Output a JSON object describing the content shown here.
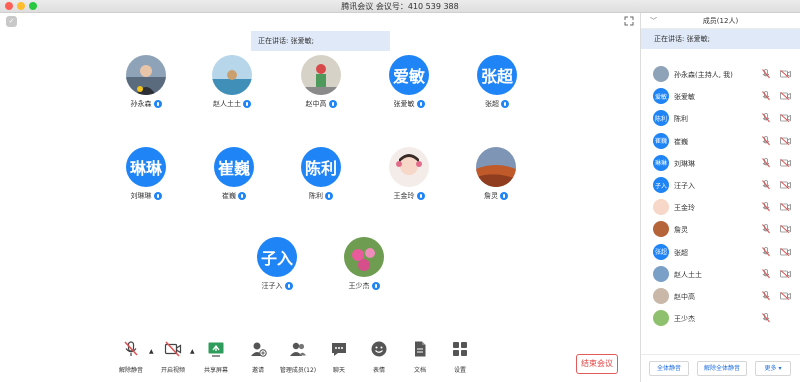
{
  "window": {
    "title": "腾讯会议 会议号：410 539 388"
  },
  "main": {
    "speaking": "正在讲话: 张爱敏;",
    "participants": [
      {
        "name": "孙永森",
        "avatar_type": "photo",
        "avatar_text": ""
      },
      {
        "name": "赵人土土",
        "avatar_type": "photo",
        "avatar_text": ""
      },
      {
        "name": "赵中高",
        "avatar_type": "photo",
        "avatar_text": ""
      },
      {
        "name": "张爱敏",
        "avatar_type": "text",
        "avatar_text": "爱敏"
      },
      {
        "name": "张超",
        "avatar_type": "text",
        "avatar_text": "张超"
      },
      {
        "name": "刘琳琳",
        "avatar_type": "text",
        "avatar_text": "琳琳"
      },
      {
        "name": "崔巍",
        "avatar_type": "text",
        "avatar_text": "崔巍"
      },
      {
        "name": "陈利",
        "avatar_type": "text",
        "avatar_text": "陈利"
      },
      {
        "name": "王金玲",
        "avatar_type": "photo",
        "avatar_text": ""
      },
      {
        "name": "詹灵",
        "avatar_type": "photo",
        "avatar_text": ""
      },
      {
        "name": "汪子入",
        "avatar_type": "text",
        "avatar_text": "子入"
      },
      {
        "name": "王少杰",
        "avatar_type": "photo",
        "avatar_text": ""
      }
    ]
  },
  "toolbar": {
    "items": [
      {
        "label": "解除静音",
        "icon": "muted-mic-icon"
      },
      {
        "label": "开启视频",
        "icon": "video-off-icon"
      },
      {
        "label": "共享屏幕",
        "icon": "share-screen-icon"
      },
      {
        "label": "邀请",
        "icon": "invite-icon"
      },
      {
        "label": "管理成员(12)",
        "icon": "manage-members-icon"
      },
      {
        "label": "聊天",
        "icon": "chat-icon"
      },
      {
        "label": "表情",
        "icon": "emoji-icon"
      },
      {
        "label": "文档",
        "icon": "document-icon"
      },
      {
        "label": "设置",
        "icon": "settings-icon"
      }
    ],
    "end_label": "结束会议"
  },
  "panel": {
    "title": "成员(12人)",
    "speaking": "正在讲话: 张爱敏;",
    "members": [
      {
        "name": "孙永森(主持人, 我)",
        "avatar_type": "photo",
        "avatar_text": ""
      },
      {
        "name": "张爱敏",
        "avatar_type": "text",
        "avatar_text": "爱敏"
      },
      {
        "name": "陈利",
        "avatar_type": "text",
        "avatar_text": "陈利"
      },
      {
        "name": "崔巍",
        "avatar_type": "text",
        "avatar_text": "崔巍"
      },
      {
        "name": "刘琳琳",
        "avatar_type": "text",
        "avatar_text": "琳琳"
      },
      {
        "name": "汪子入",
        "avatar_type": "text",
        "avatar_text": "子入"
      },
      {
        "name": "王金玲",
        "avatar_type": "photo",
        "avatar_text": ""
      },
      {
        "name": "詹灵",
        "avatar_type": "photo",
        "avatar_text": ""
      },
      {
        "name": "张超",
        "avatar_type": "text",
        "avatar_text": "张超"
      },
      {
        "name": "赵人土土",
        "avatar_type": "photo",
        "avatar_text": ""
      },
      {
        "name": "赵中高",
        "avatar_type": "photo",
        "avatar_text": ""
      },
      {
        "name": "王少杰",
        "avatar_type": "photo",
        "avatar_text": ""
      }
    ],
    "footer": {
      "mute_all": "全体静音",
      "unmute_all": "解除全体静音",
      "more": "更多 ▾"
    }
  },
  "colors": {
    "accent": "#1f84f5",
    "end": "#e04444",
    "muted": "#e05050",
    "banner": "#dfe9f7"
  }
}
